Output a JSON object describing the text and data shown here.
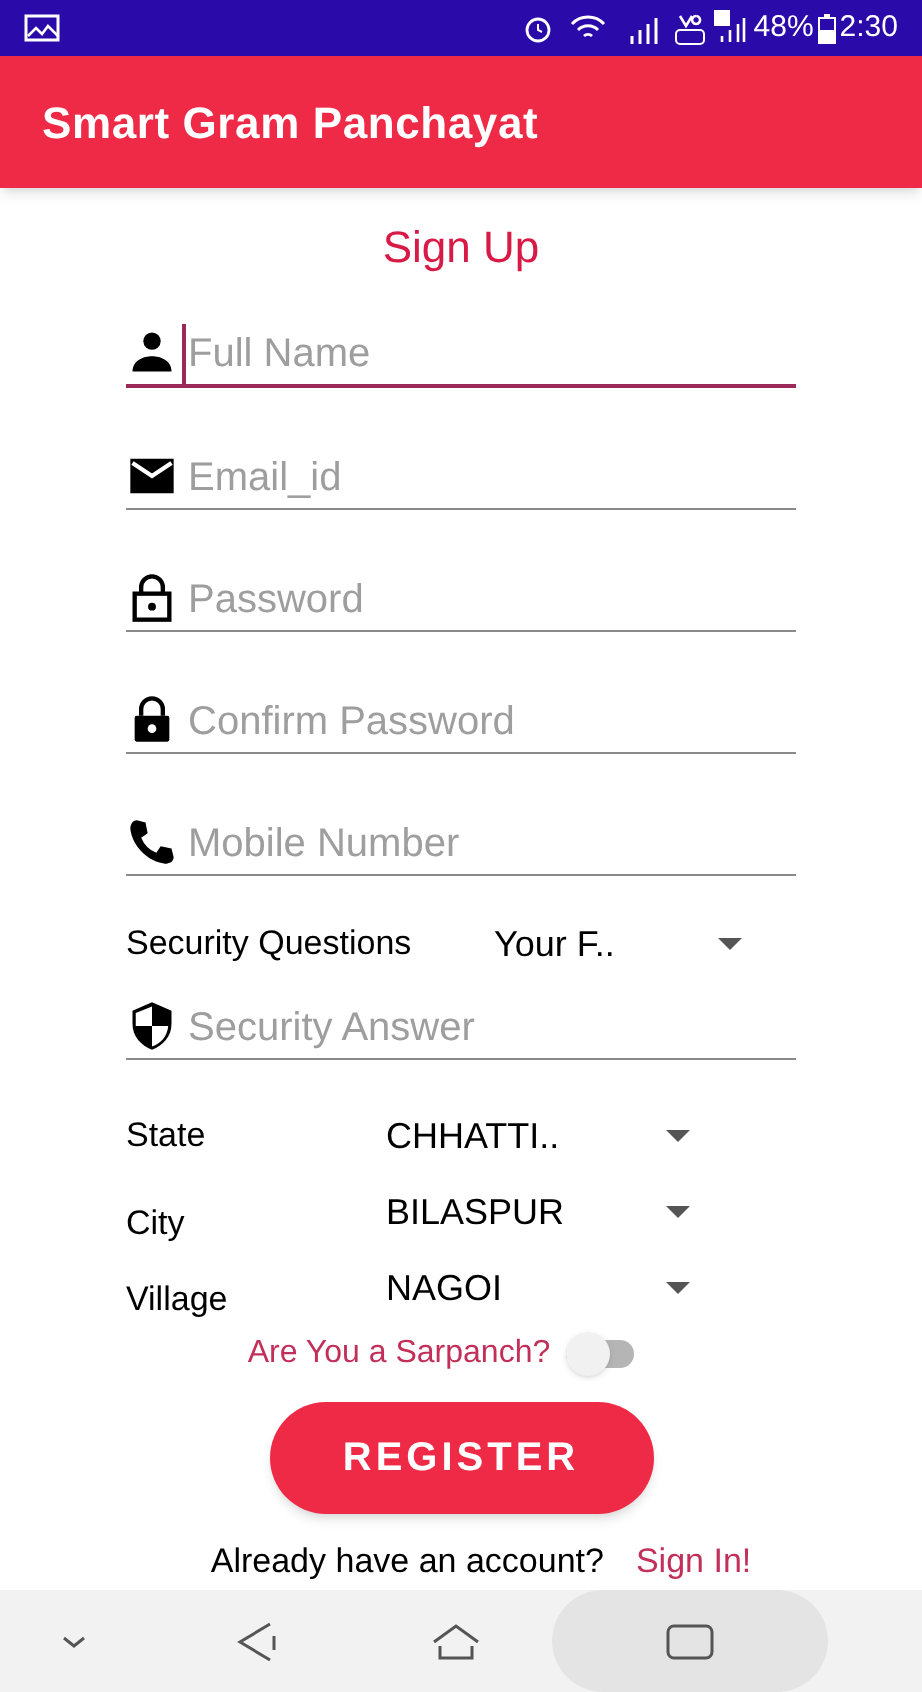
{
  "status_bar": {
    "battery": "48%",
    "time": "2:30"
  },
  "app_bar": {
    "title": "Smart Gram Panchayat"
  },
  "heading": "Sign Up",
  "fields": [
    {
      "placeholder": "Full Name",
      "focused": true
    },
    {
      "placeholder": "Email_id",
      "focused": false
    },
    {
      "placeholder": "Password",
      "focused": false
    },
    {
      "placeholder": "Confirm Password",
      "focused": false
    },
    {
      "placeholder": "Mobile Number",
      "focused": false
    }
  ],
  "security_question": {
    "label": "Security Questions",
    "value": "Your F.."
  },
  "security_answer": {
    "placeholder": "Security Answer",
    "focused": false
  },
  "location": [
    {
      "label": "State",
      "value": "CHHATTI.."
    },
    {
      "label": "City",
      "value": "BILASPUR"
    },
    {
      "label": "Village",
      "value": "NAGOI"
    }
  ],
  "sarpanch": {
    "label": "Are You a Sarpanch?",
    "on": false
  },
  "register_button": "REGISTER",
  "sign_in": {
    "prompt": "Already have an account?",
    "link": "Sign In!"
  }
}
